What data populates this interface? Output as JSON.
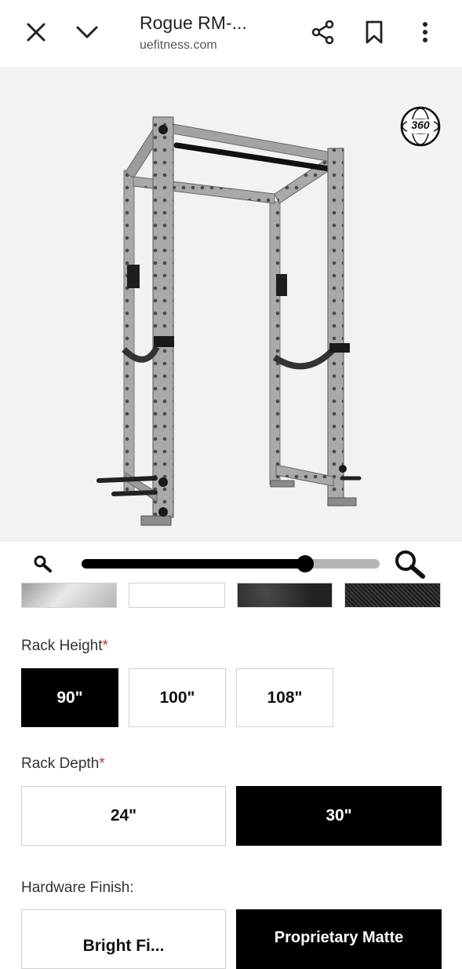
{
  "topbar": {
    "title": "Rogue RM-...",
    "subtitle": "uefitness.com"
  },
  "viewer": {
    "badge_label": "360",
    "zoom_level": 0.75
  },
  "finish_swatches": [
    {
      "name": "silver",
      "color": "#c8c8c8"
    },
    {
      "name": "white",
      "color": "#ffffff"
    },
    {
      "name": "black-textured",
      "color": "#2e2e2e"
    },
    {
      "name": "black-grain",
      "color": "#1a1a1a"
    }
  ],
  "rack_height": {
    "label": "Rack Height",
    "required_mark": "*",
    "options": [
      "90\"",
      "100\"",
      "108\""
    ],
    "selected": "90\""
  },
  "rack_depth": {
    "label": "Rack Depth",
    "required_mark": "*",
    "options": [
      "24\"",
      "30\""
    ],
    "selected": "30\""
  },
  "hardware_finish": {
    "label": "Hardware Finish:",
    "options": [
      "Bright Fi...",
      "Proprietary Matte"
    ],
    "selected": "Proprietary Matte"
  }
}
